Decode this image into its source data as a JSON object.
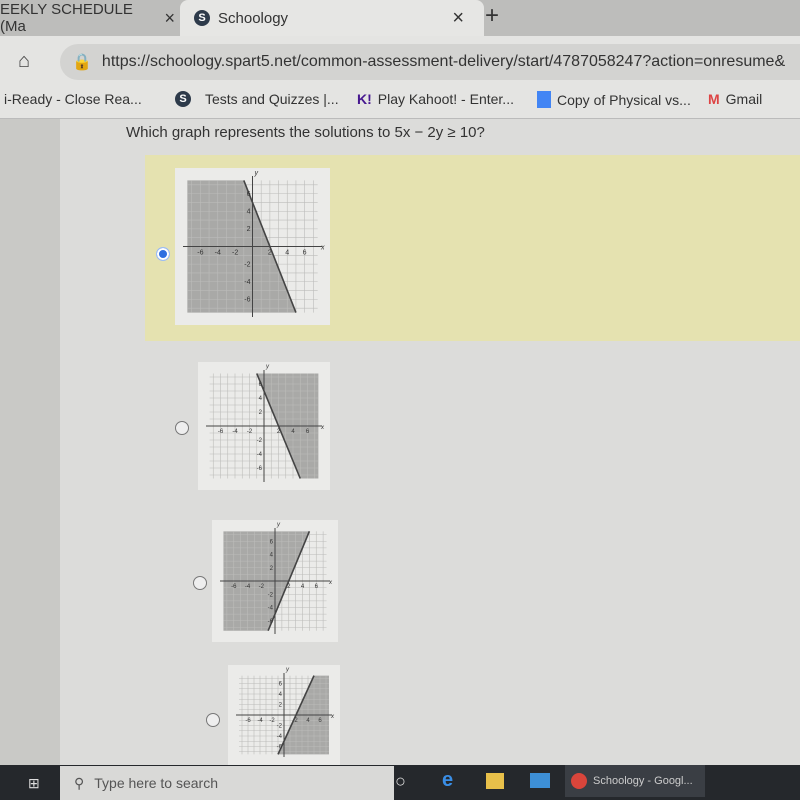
{
  "browser": {
    "tabs": [
      {
        "label": "EEKLY SCHEDULE (Ma"
      },
      {
        "label": "Schoology",
        "active": true
      }
    ],
    "close_glyph": "×",
    "new_tab_glyph": "+",
    "url": "https://schoology.spart5.net/common-assessment-delivery/start/4787058247?action=onresume&",
    "bookmarks": [
      {
        "label": "i-Ready - Close Rea..."
      },
      {
        "label": "Tests and Quizzes |..."
      },
      {
        "label": "Play Kahoot! - Enter..."
      },
      {
        "label": "Copy of Physical vs..."
      },
      {
        "label": "Gmail"
      }
    ]
  },
  "question": {
    "text": "Which graph represents the solutions to 5x − 2y ≥ 10?"
  },
  "graph_ticks": {
    "x": [
      "-6",
      "-4",
      "-2",
      "2",
      "4",
      "6"
    ],
    "y": [
      "6",
      "4",
      "2",
      "-2",
      "-4",
      "-6"
    ],
    "xlabel": "x",
    "ylabel": "y"
  },
  "colors": {
    "shade": "#a9a9a7",
    "selected_bg": "#e5e2b0",
    "radio_selected": "#2d6fe0"
  },
  "options": [
    {
      "selected": true,
      "line": [
        [
          -1,
          7.5
        ],
        [
          5,
          -7.5
        ]
      ],
      "shade": "left"
    },
    {
      "selected": false,
      "line": [
        [
          -1,
          7.5
        ],
        [
          5,
          -7.5
        ]
      ],
      "shade": "right"
    },
    {
      "selected": false,
      "line": [
        [
          -1,
          -7.5
        ],
        [
          5,
          7.5
        ]
      ],
      "shade": "left"
    },
    {
      "selected": false,
      "line": [
        [
          -1,
          -7.5
        ],
        [
          5,
          7.5
        ]
      ],
      "shade": "right"
    }
  ],
  "taskbar": {
    "search_placeholder": "Type here to search",
    "app_label": "Schoology - Googl..."
  }
}
